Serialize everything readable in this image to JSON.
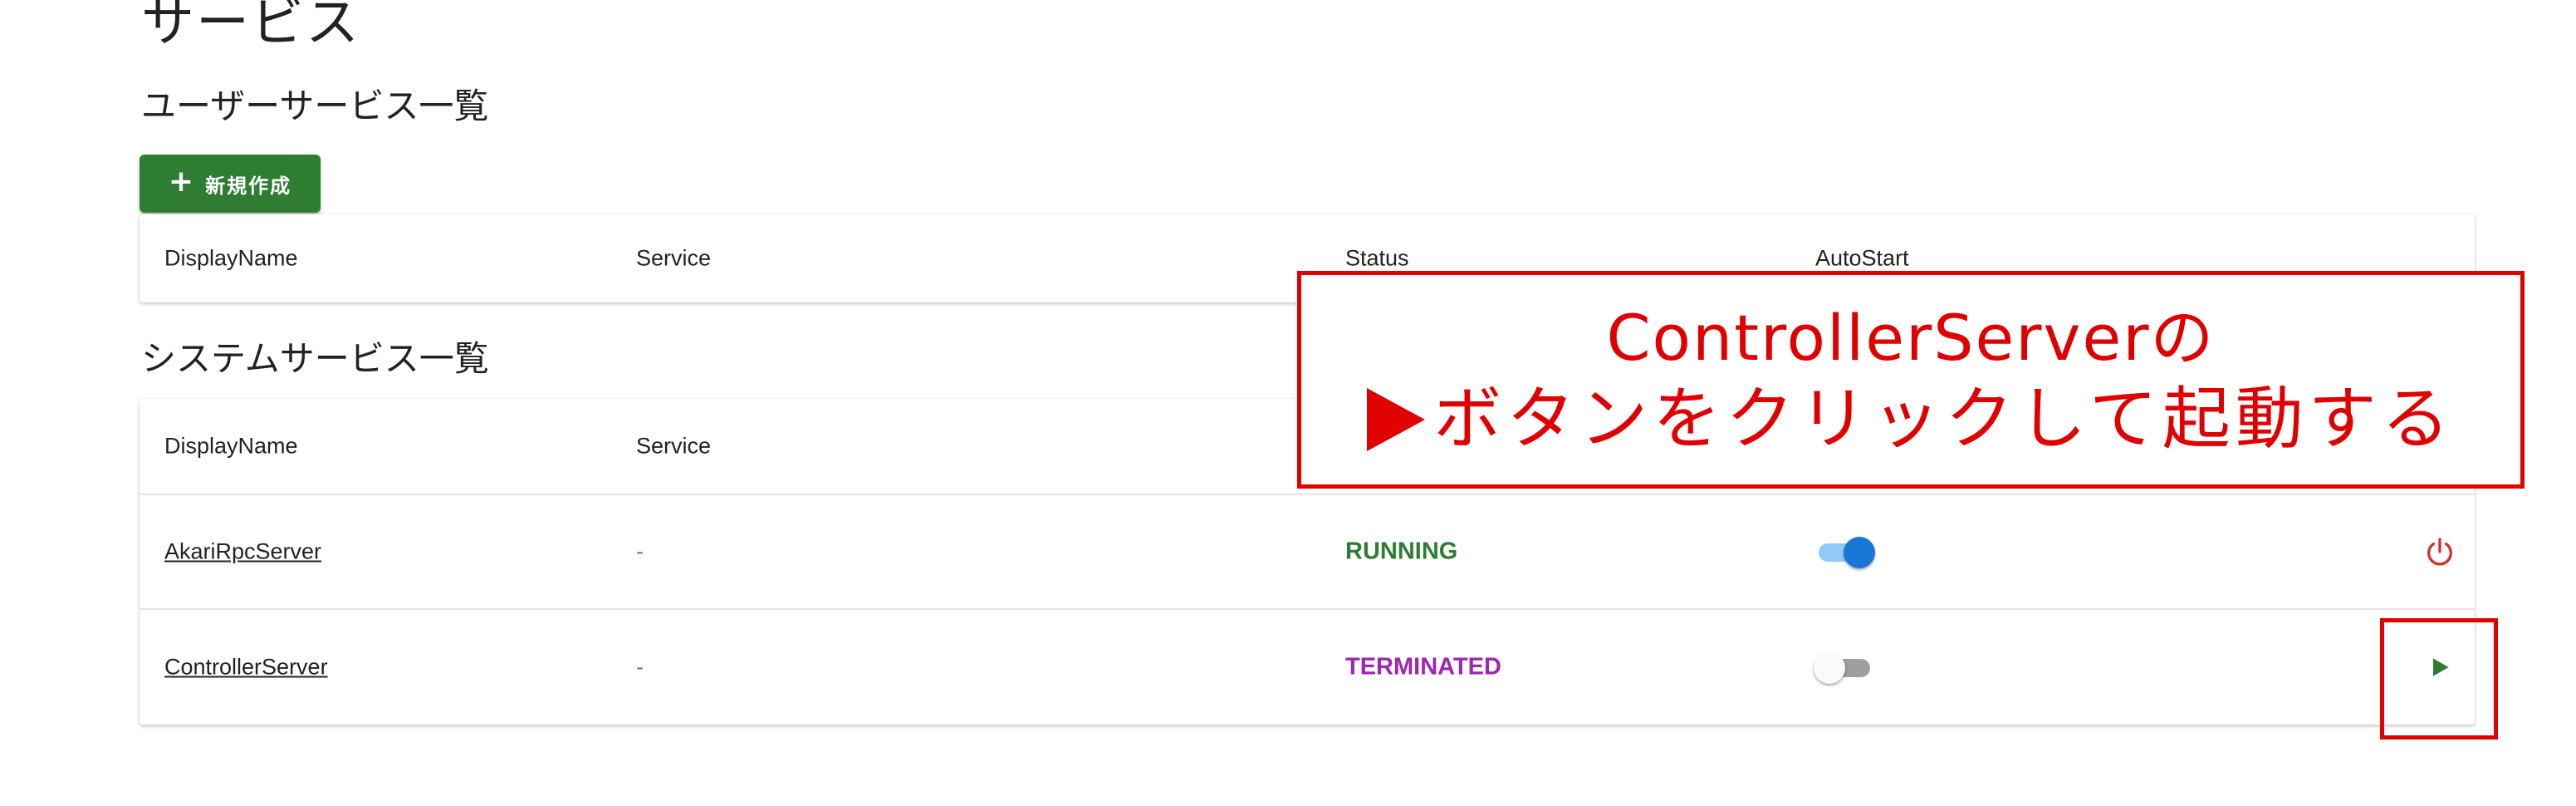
{
  "page": {
    "title": "サービス"
  },
  "user_services": {
    "title": "ユーザーサービス一覧",
    "new_button": {
      "icon": "plus-icon",
      "label": "新規作成"
    },
    "columns": [
      "DisplayName",
      "Service",
      "Status",
      "AutoStart"
    ]
  },
  "system_services": {
    "title": "システムサービス一覧",
    "columns": [
      "DisplayName",
      "Service"
    ],
    "rows": [
      {
        "display_name": "AkariRpcServer",
        "service": "-",
        "status": "RUNNING",
        "autostart": true,
        "action_icon": "power-icon"
      },
      {
        "display_name": "ControllerServer",
        "service": "-",
        "status": "TERMINATED",
        "autostart": false,
        "action_icon": "play-icon"
      }
    ]
  },
  "annotation": {
    "line1": "ControllerServerの",
    "line2": "ボタンをクリックして起動する",
    "color": "#e00000"
  },
  "colors": {
    "primary_green": "#2e7d32",
    "running": "#2e7d32",
    "terminated": "#9c27b0",
    "toggle_on": "#1976d2",
    "power_icon": "#d32f2f"
  }
}
